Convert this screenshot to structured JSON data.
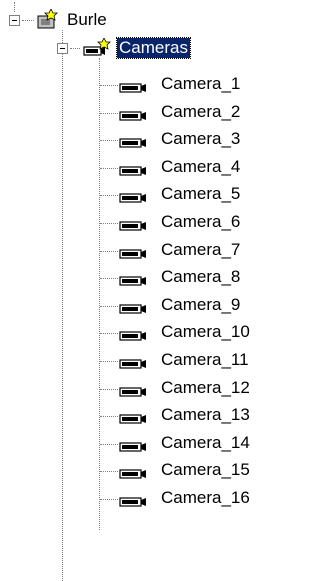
{
  "tree": {
    "root": {
      "label": "Burle",
      "icon": "site-icon",
      "expanded": true
    },
    "group": {
      "label": "Cameras",
      "icon": "camera-group-icon",
      "expanded": true,
      "selected": true
    },
    "cameras": [
      "Camera_1",
      "Camera_2",
      "Camera_3",
      "Camera_4",
      "Camera_5",
      "Camera_6",
      "Camera_7",
      "Camera_8",
      "Camera_9",
      "Camera_10",
      "Camera_11",
      "Camera_12",
      "Camera_13",
      "Camera_14",
      "Camera_15",
      "Camera_16"
    ],
    "camera_icon": "camera-icon",
    "colors": {
      "selection": "#0a246a",
      "lines": "#808080",
      "icon_yellow": "#ffff00"
    }
  }
}
